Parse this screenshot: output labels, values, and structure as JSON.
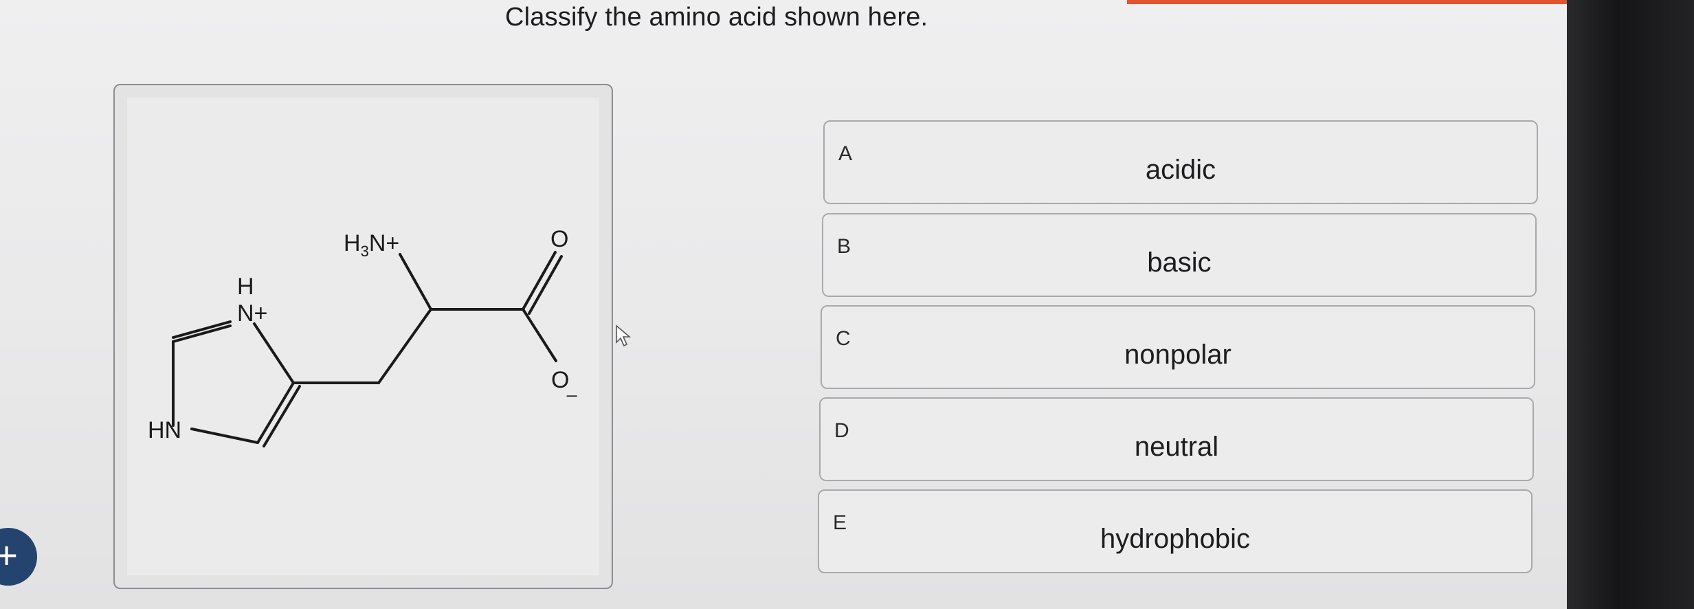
{
  "question": {
    "text": "Classify the amino acid shown here."
  },
  "structure": {
    "labels": {
      "amine_group": "H3N+",
      "carbonyl_oxygen": "O",
      "carboxylate_oxygen": "O",
      "charge_minus": "_",
      "ring_nitrogen_charged": "N+",
      "ring_nitrogen_h": "H",
      "ring_nh": "HN"
    }
  },
  "options": [
    {
      "letter": "A",
      "text": "acidic"
    },
    {
      "letter": "B",
      "text": "basic"
    },
    {
      "letter": "C",
      "text": "nonpolar"
    },
    {
      "letter": "D",
      "text": "neutral"
    },
    {
      "letter": "E",
      "text": "hydrophobic"
    }
  ],
  "fab": {
    "label": "+"
  },
  "colors": {
    "accent": "#e2542f",
    "fab": "#24436f"
  }
}
